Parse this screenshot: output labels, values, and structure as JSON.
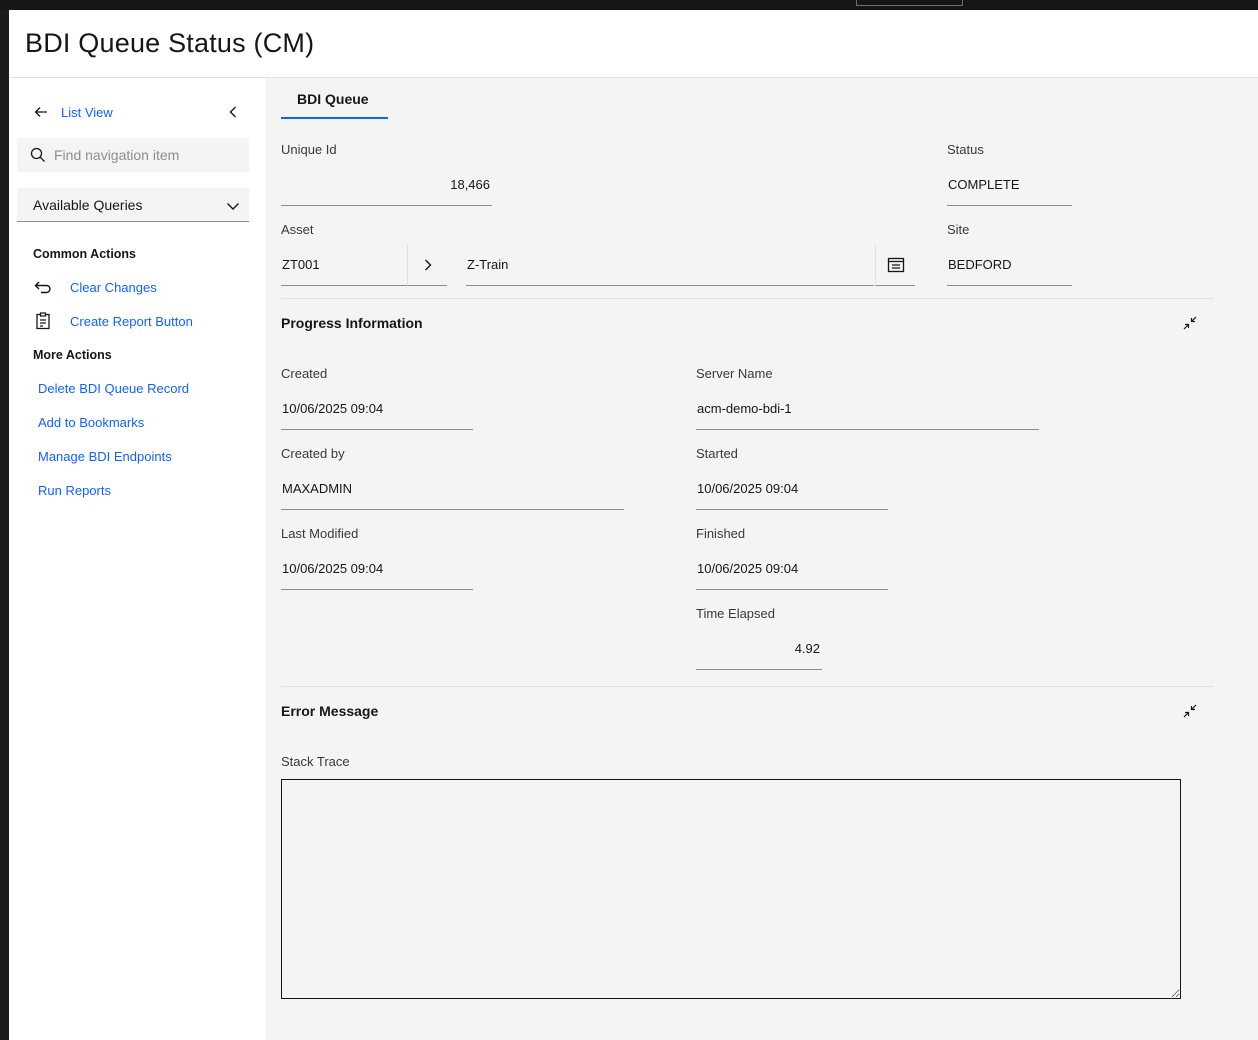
{
  "page": {
    "title": "BDI Queue Status (CM)"
  },
  "sidebar": {
    "back_label": "List View",
    "search_placeholder": "Find navigation item",
    "queries_label": "Available Queries",
    "common_actions_heading": "Common Actions",
    "common_actions": [
      {
        "label": "Clear Changes",
        "icon": "undo-icon"
      },
      {
        "label": "Create Report Button",
        "icon": "report-icon"
      }
    ],
    "more_actions_heading": "More Actions",
    "more_actions": [
      {
        "label": "Delete BDI Queue Record"
      },
      {
        "label": "Add to Bookmarks"
      },
      {
        "label": "Manage BDI Endpoints"
      },
      {
        "label": "Run Reports"
      }
    ]
  },
  "main": {
    "tab_label": "BDI Queue",
    "header": {
      "unique_id_label": "Unique Id",
      "unique_id": "18,466",
      "status_label": "Status",
      "status": "COMPLETE",
      "asset_label": "Asset",
      "asset_code": "ZT001",
      "asset_description": "Z-Train",
      "site_label": "Site",
      "site": "BEDFORD"
    },
    "progress": {
      "title": "Progress Information",
      "created_label": "Created",
      "created": "10/06/2025 09:04",
      "created_by_label": "Created by",
      "created_by": "MAXADMIN",
      "last_modified_label": "Last Modified",
      "last_modified": "10/06/2025 09:04",
      "server_name_label": "Server Name",
      "server_name": "acm-demo-bdi-1",
      "started_label": "Started",
      "started": "10/06/2025 09:04",
      "finished_label": "Finished",
      "finished": "10/06/2025 09:04",
      "time_elapsed_label": "Time Elapsed",
      "time_elapsed": "4.92"
    },
    "error": {
      "title": "Error Message",
      "stack_trace_label": "Stack Trace",
      "stack_trace": ""
    }
  },
  "colors": {
    "accent": "#0f62fe",
    "background": "#f4f4f4",
    "text": "#161616"
  }
}
